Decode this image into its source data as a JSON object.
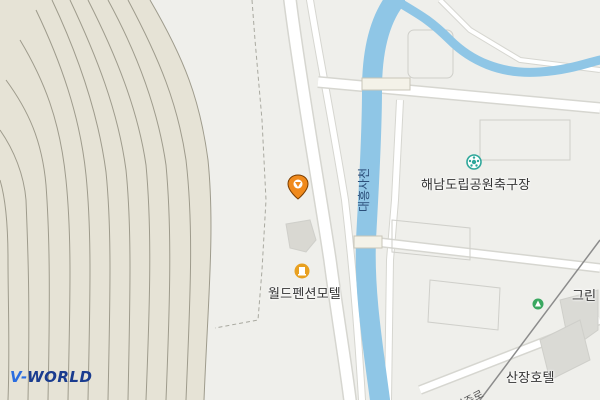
{
  "map": {
    "water": {
      "name": "대흥사천",
      "color": "#8fc6e6"
    },
    "labels": {
      "motel_world": "월드펜션모텔",
      "soccer_field": "해남도립공원축구장",
      "motel_sanjang": "산장호텔",
      "green_partial": "그린",
      "road_partial": "일주로"
    },
    "icons": {
      "selected_marker": "location-pin-icon",
      "lodging": "lodging-icon",
      "soccer": "soccer-ball-icon",
      "bus": "bus-stop-icon"
    },
    "colors": {
      "background": "#efefeb",
      "contour": "#9e9b8c",
      "hill_fill": "#e3e0d2",
      "road": "#ffffff",
      "road_edge": "#d6d6d0",
      "marker": "#f08a1c",
      "poi_orange": "#e8a020",
      "poi_teal": "#2ea79a"
    }
  },
  "branding": {
    "logo_prefix": "V-",
    "logo_text": "WORLD"
  }
}
